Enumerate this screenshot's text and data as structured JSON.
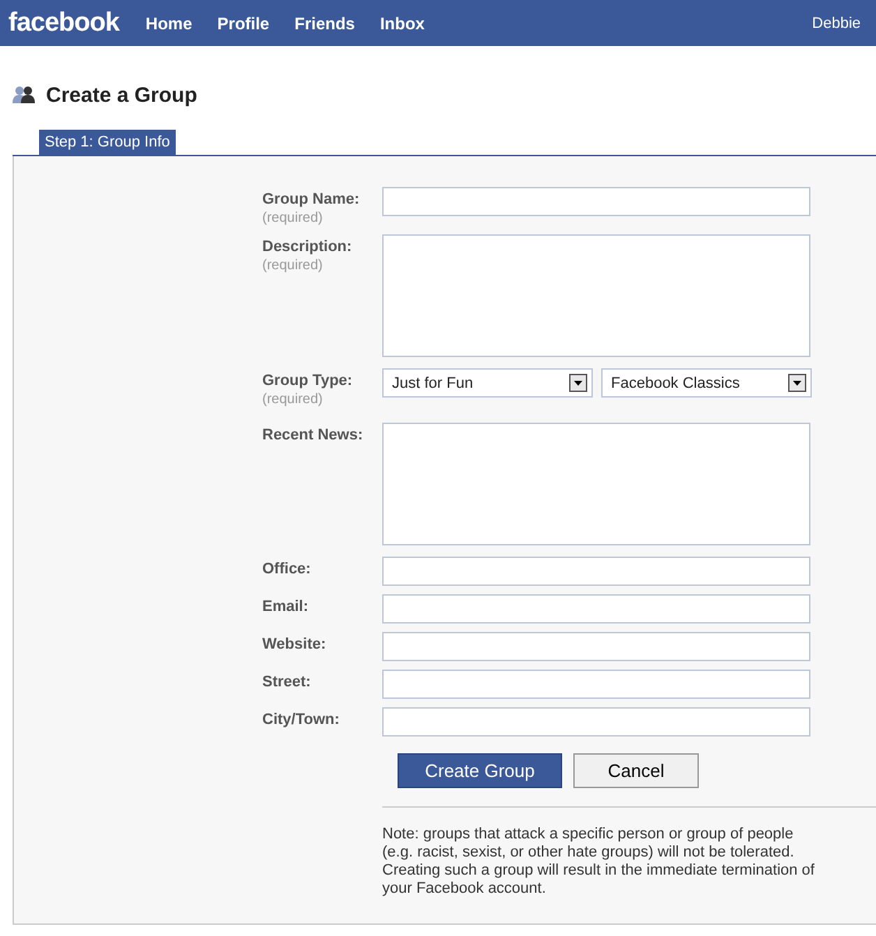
{
  "topbar": {
    "logo": "facebook",
    "nav": [
      "Home",
      "Profile",
      "Friends",
      "Inbox"
    ],
    "user": "Debbie"
  },
  "page": {
    "title": "Create a Group"
  },
  "tabs": [
    {
      "label": "Step 1: Group Info",
      "selected": true
    }
  ],
  "form": {
    "fields": [
      {
        "kind": "text",
        "label": "Group Name:",
        "hint": "(required)"
      },
      {
        "kind": "textarea",
        "label": "Description:",
        "hint": "(required)"
      },
      {
        "kind": "selects",
        "label": "Group Type:",
        "hint": "(required)",
        "values": [
          "Just for Fun",
          "Facebook Classics"
        ]
      },
      {
        "kind": "textarea",
        "label": "Recent News:"
      },
      {
        "kind": "text",
        "label": "Office:"
      },
      {
        "kind": "text",
        "label": "Email:"
      },
      {
        "kind": "text",
        "label": "Website:"
      },
      {
        "kind": "text",
        "label": "Street:"
      },
      {
        "kind": "text",
        "label": "City/Town:"
      }
    ],
    "buttons": [
      {
        "label": "Create Group",
        "kind": "primary"
      },
      {
        "label": "Cancel",
        "kind": "secondary"
      }
    ],
    "note": "Note: groups that attack a specific person or group of people (e.g. racist, sexist, or other hate groups) will not be tolerated. Creating such a group will result in the immediate termination of your Facebook account."
  }
}
